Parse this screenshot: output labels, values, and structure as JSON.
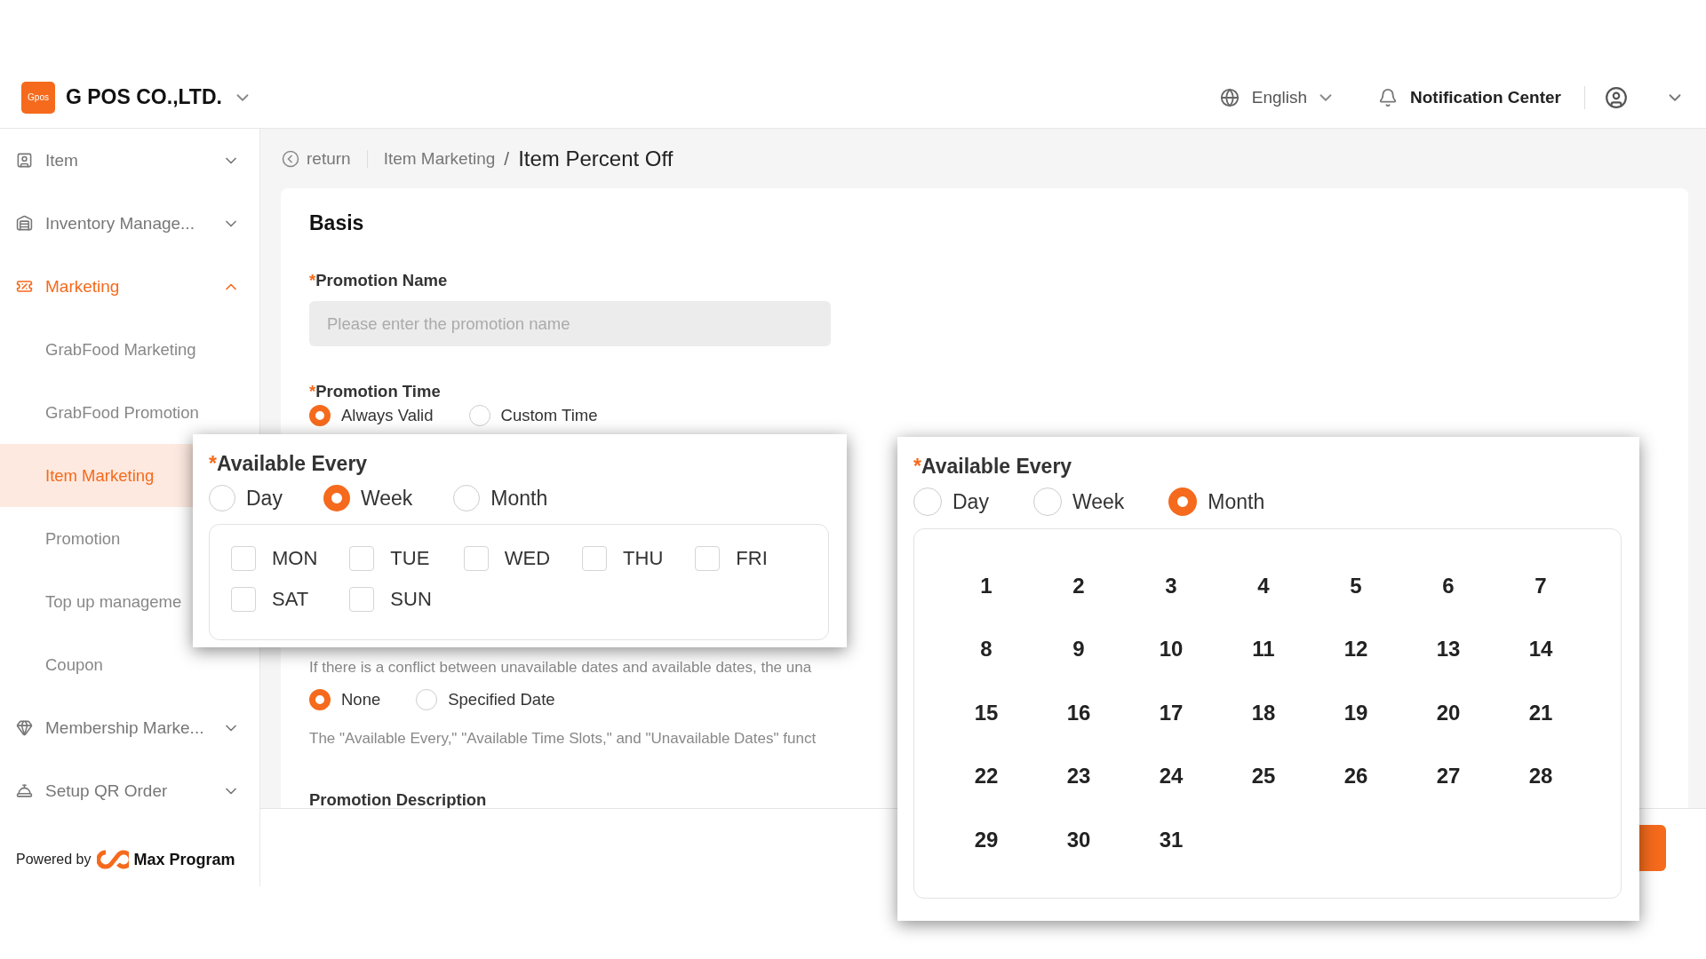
{
  "header": {
    "company": "G POS CO.,LTD.",
    "logo_text": "Gpos",
    "language": "English",
    "notification": "Notification Center"
  },
  "sidebar": {
    "items": [
      {
        "label": "Item",
        "expanded": false,
        "selected": false
      },
      {
        "label": "Inventory Manage...",
        "expanded": false,
        "selected": false
      },
      {
        "label": "Marketing",
        "expanded": true,
        "selected": true,
        "children": [
          {
            "label": "GrabFood Marketing",
            "selected": false
          },
          {
            "label": "GrabFood Promotion",
            "selected": false
          },
          {
            "label": "Item Marketing",
            "selected": true
          },
          {
            "label": "Promotion",
            "selected": false
          },
          {
            "label": "Top up manageme",
            "selected": false
          },
          {
            "label": "Coupon",
            "selected": false
          }
        ]
      },
      {
        "label": "Membership Marke...",
        "expanded": false,
        "selected": false
      },
      {
        "label": "Setup QR Order",
        "expanded": false,
        "selected": false
      }
    ],
    "footer": {
      "prefix": "Powered by",
      "brand": "Max Program"
    }
  },
  "breadcrumb": {
    "back": "return",
    "parent": "Item Marketing",
    "separator": "/",
    "current": "Item Percent Off"
  },
  "form": {
    "section": "Basis",
    "promotion_name": {
      "required_mark": "*",
      "label": "Promotion Name",
      "placeholder": "Please enter the promotion name"
    },
    "promotion_time": {
      "required_mark": "*",
      "label": "Promotion Time",
      "options": [
        {
          "label": "Always Valid",
          "selected": true
        },
        {
          "label": "Custom Time",
          "selected": false
        }
      ]
    },
    "conflict_note": "If there is a conflict between unavailable dates and available dates, the una",
    "unavailable_dates": {
      "options": [
        {
          "label": "None",
          "selected": true
        },
        {
          "label": "Specified Date",
          "selected": false
        }
      ]
    },
    "info_note": "The \"Available Every,\" \"Available Time Slots,\" and \"Unavailable Dates\" funct",
    "description_label": "Promotion Description"
  },
  "popups": [
    {
      "kind": "week",
      "required_mark": "*",
      "label": "Available Every",
      "options": [
        {
          "label": "Day",
          "selected": false
        },
        {
          "label": "Week",
          "selected": true
        },
        {
          "label": "Month",
          "selected": false
        }
      ],
      "days": [
        {
          "label": "MON",
          "checked": false
        },
        {
          "label": "TUE",
          "checked": false
        },
        {
          "label": "WED",
          "checked": false
        },
        {
          "label": "THU",
          "checked": false
        },
        {
          "label": "FRI",
          "checked": false
        },
        {
          "label": "SAT",
          "checked": false
        },
        {
          "label": "SUN",
          "checked": false
        }
      ]
    },
    {
      "kind": "month",
      "required_mark": "*",
      "label": "Available Every",
      "options": [
        {
          "label": "Day",
          "selected": false
        },
        {
          "label": "Week",
          "selected": false
        },
        {
          "label": "Month",
          "selected": true
        }
      ],
      "dates": [
        "1",
        "2",
        "3",
        "4",
        "5",
        "6",
        "7",
        "8",
        "9",
        "10",
        "11",
        "12",
        "13",
        "14",
        "15",
        "16",
        "17",
        "18",
        "19",
        "20",
        "21",
        "22",
        "23",
        "24",
        "25",
        "26",
        "27",
        "28",
        "29",
        "30",
        "31"
      ]
    }
  ]
}
